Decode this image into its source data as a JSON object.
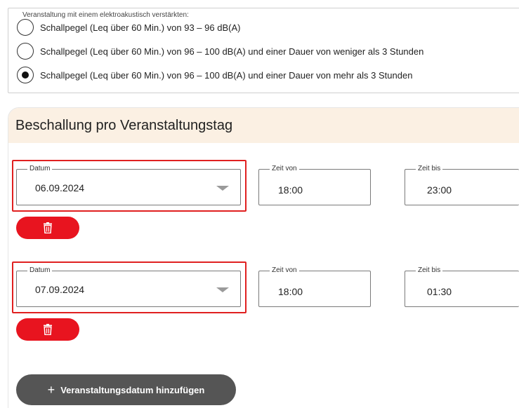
{
  "volume_options": {
    "legend": "Veranstaltung mit einem elektroakustisch verstärkten:",
    "options": [
      {
        "label": "Schallpegel (Leq über 60 Min.) von 93 – 96 dB(A)",
        "checked": false
      },
      {
        "label": "Schallpegel (Leq über 60 Min.) von 96 – 100 dB(A) und einer Dauer von weniger als 3 Stunden",
        "checked": false
      },
      {
        "label": "Schallpegel (Leq über 60 Min.) von 96 – 100 dB(A) und einer Dauer von mehr als 3 Stunden",
        "checked": true
      }
    ]
  },
  "section": {
    "title": "Beschallung pro Veranstaltungstag"
  },
  "entries": [
    {
      "date_label": "Datum",
      "date": "06.09.2024",
      "from_label": "Zeit von",
      "from": "18:00",
      "to_label": "Zeit bis",
      "to": "23:00"
    },
    {
      "date_label": "Datum",
      "date": "07.09.2024",
      "from_label": "Zeit von",
      "from": "18:00",
      "to_label": "Zeit bis",
      "to": "01:30"
    }
  ],
  "add_button": {
    "icon": "+",
    "label": "Veranstaltungsdatum hinzufügen"
  },
  "colors": {
    "accent_red": "#e8141f",
    "header_bg": "#fbf0e3",
    "button_gray": "#555555"
  }
}
